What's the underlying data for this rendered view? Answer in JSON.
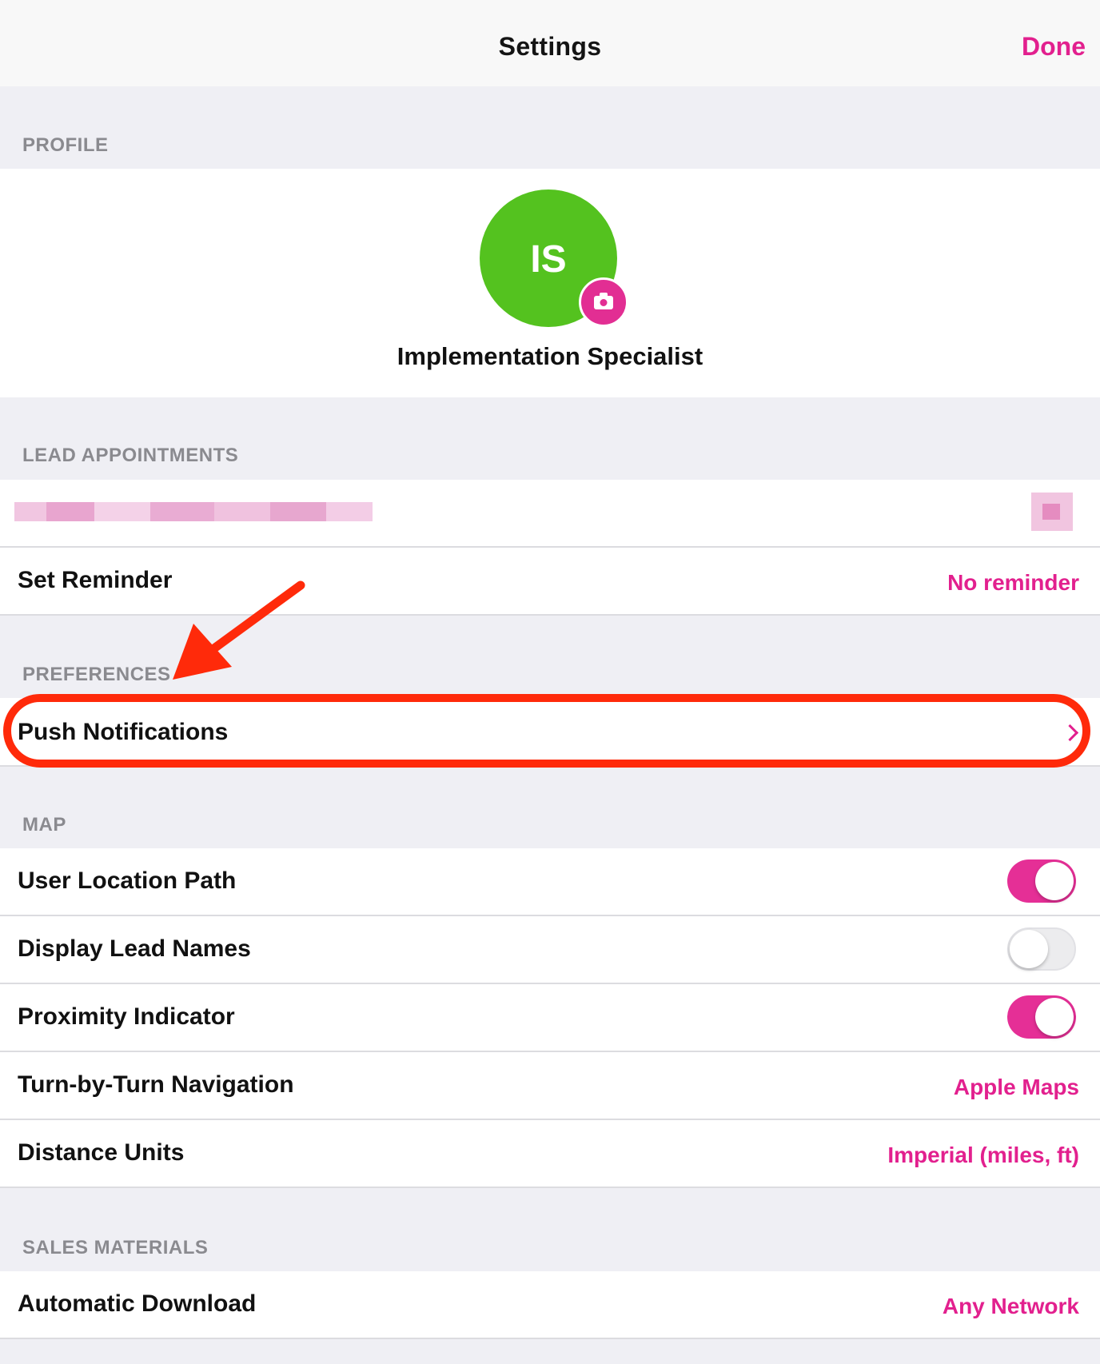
{
  "nav": {
    "title": "Settings",
    "done_label": "Done"
  },
  "profile": {
    "section_header": "PROFILE",
    "initials": "IS",
    "name": "Implementation Specialist",
    "avatar_color": "#54c21f"
  },
  "lead_appointments": {
    "section_header": "LEAD APPOINTMENTS",
    "rows": [
      {
        "label": "Set Reminder",
        "value": "No reminder"
      }
    ]
  },
  "preferences": {
    "section_header": "PREFERENCES",
    "rows": [
      {
        "label": "Push Notifications",
        "icon": "chevron-right-icon"
      }
    ]
  },
  "map": {
    "section_header": "MAP",
    "rows": [
      {
        "label": "User Location Path",
        "toggle": true
      },
      {
        "label": "Display Lead Names",
        "toggle": false
      },
      {
        "label": "Proximity Indicator",
        "toggle": true
      },
      {
        "label": "Turn-by-Turn Navigation",
        "value": "Apple Maps"
      },
      {
        "label": "Distance Units",
        "value": "Imperial (miles, ft)"
      }
    ]
  },
  "sales_materials": {
    "section_header": "SALES MATERIALS",
    "rows": [
      {
        "label": "Automatic Download",
        "value": "Any Network"
      }
    ]
  },
  "colors": {
    "accent": "#e2208e",
    "toggle_on": "#e52f96",
    "annotation": "#ff2a0a",
    "background": "#efeff4"
  }
}
